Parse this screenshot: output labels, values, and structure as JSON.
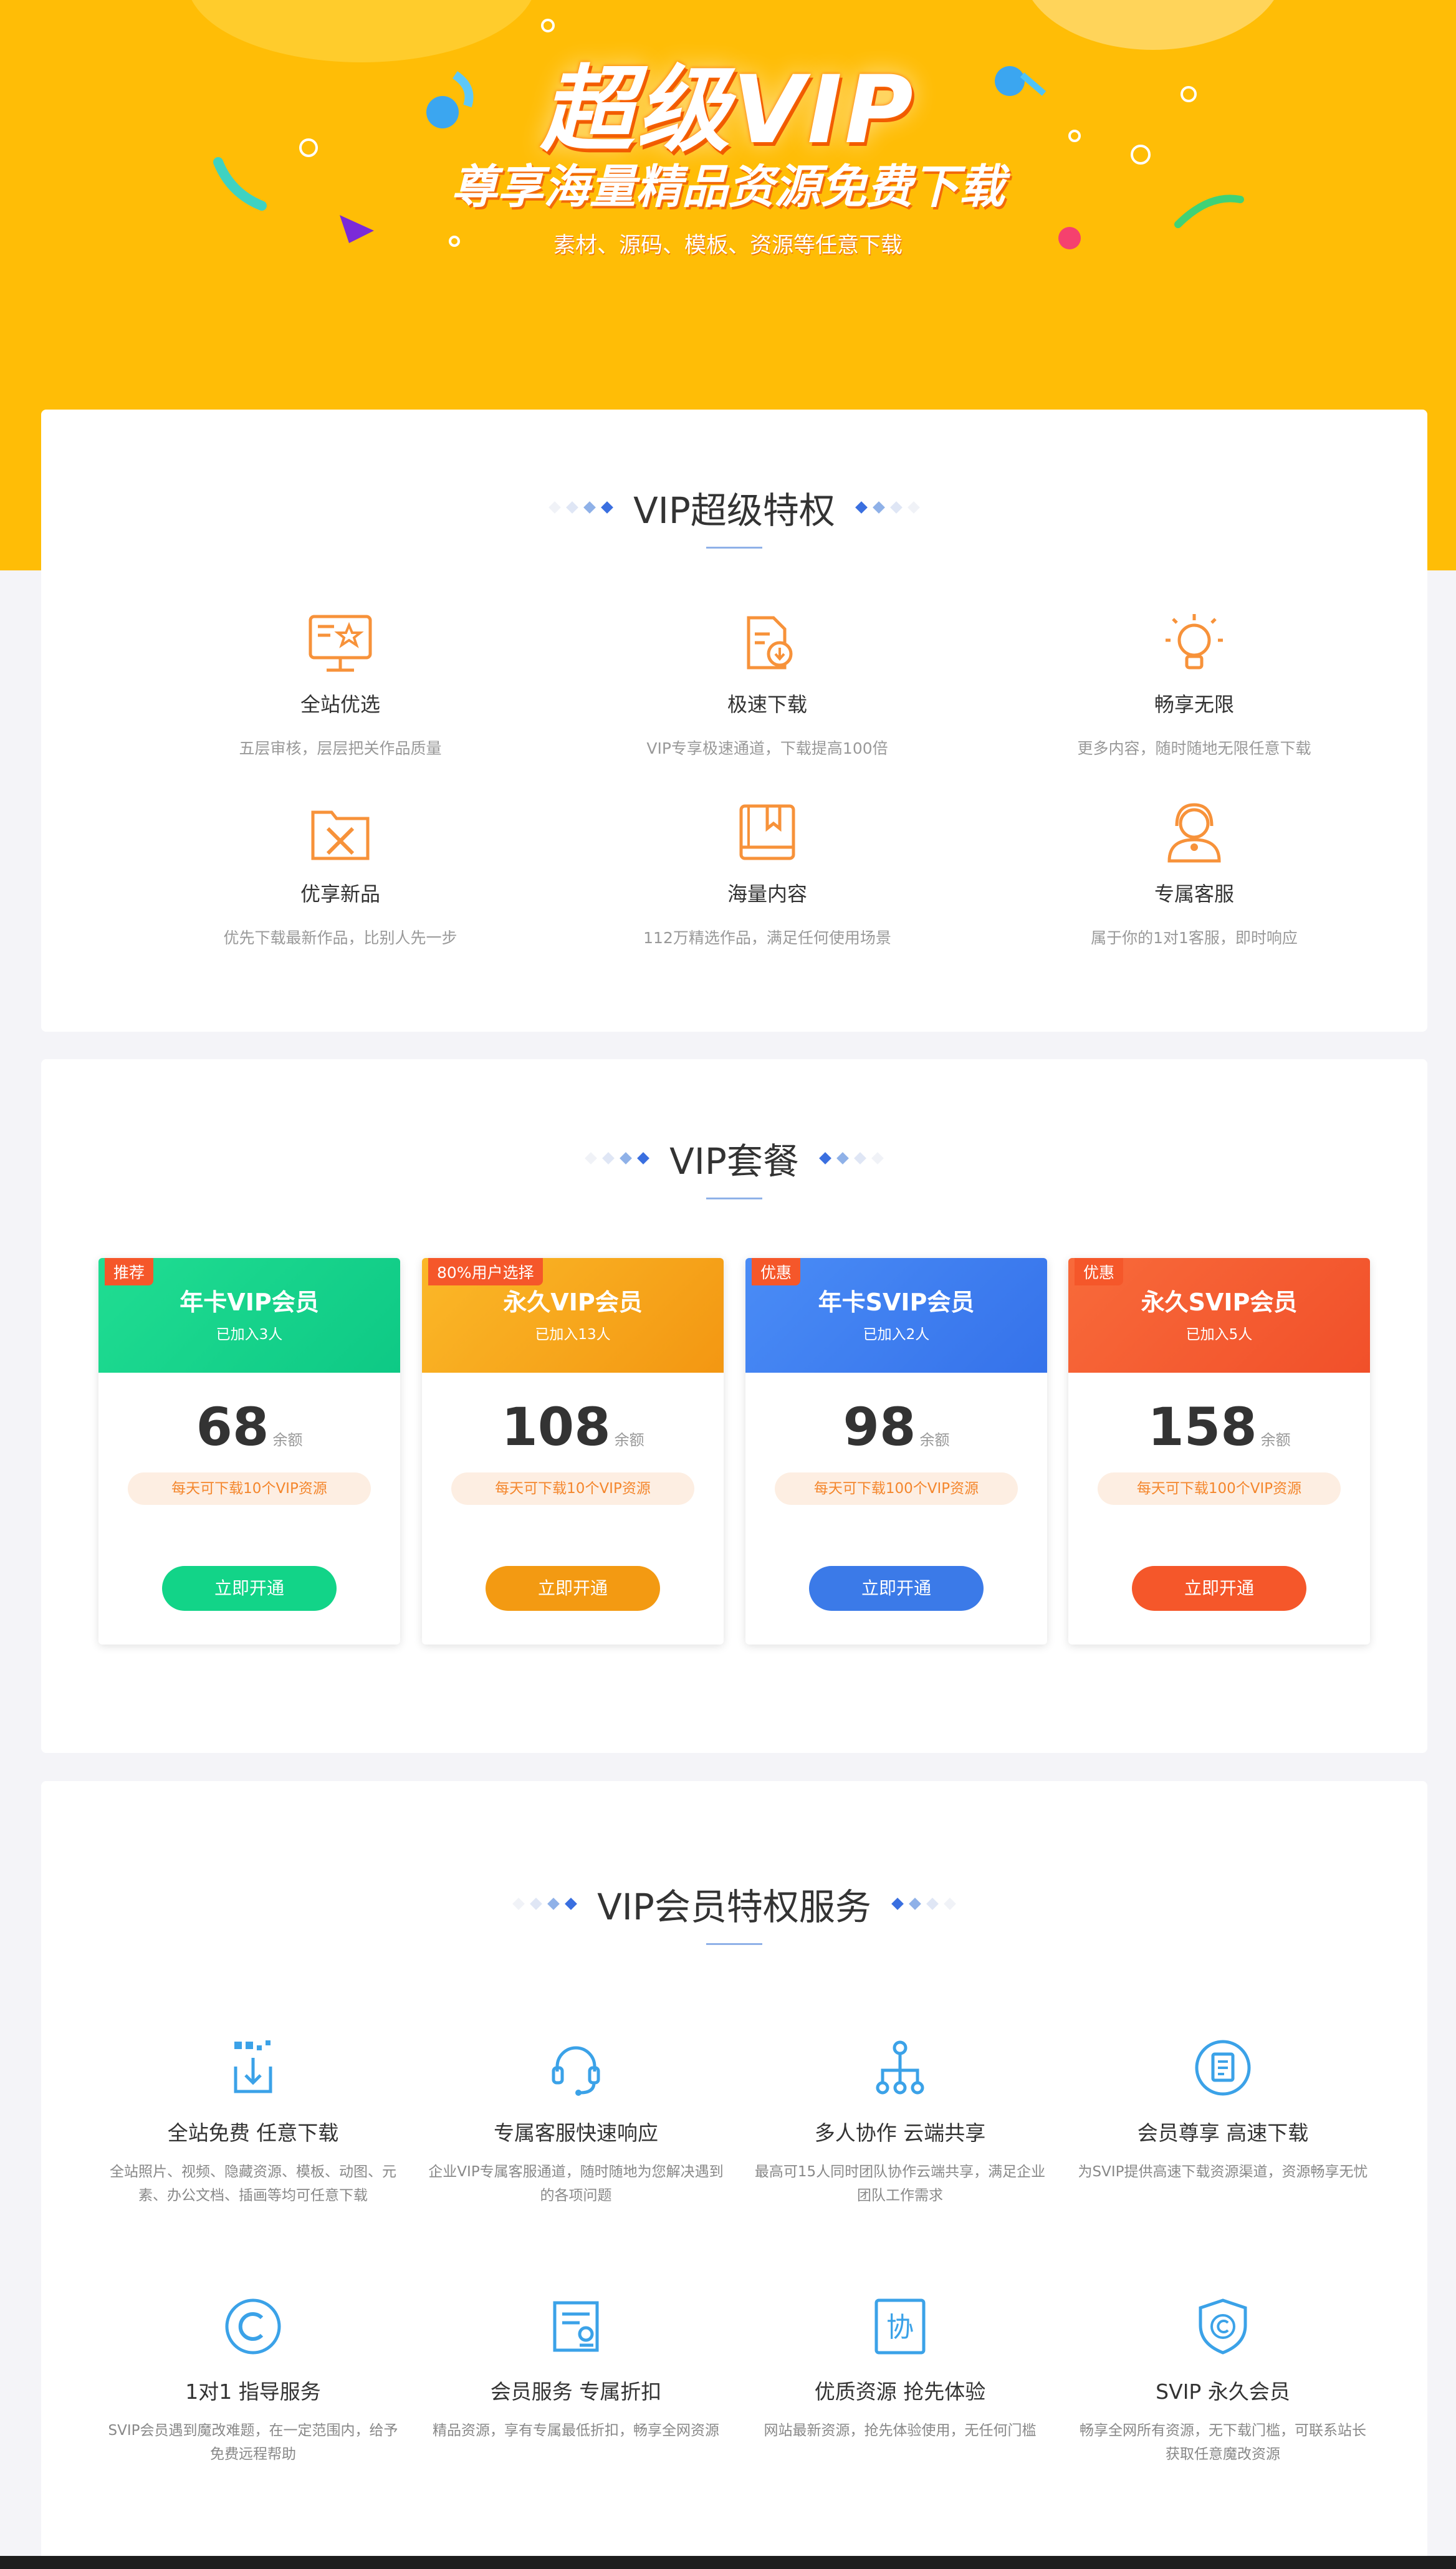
{
  "hero": {
    "title": "超级VIP",
    "subtitle": "尊享海量精品资源免费下载",
    "tagline": "素材、源码、模板、资源等任意下载"
  },
  "privileges": {
    "title": "VIP超级特权",
    "items": [
      {
        "title": "全站优选",
        "desc": "五层审核，层层把关作品质量",
        "icon": "monitor-star-icon"
      },
      {
        "title": "极速下载",
        "desc": "VIP专享极速通道，下载提高100倍",
        "icon": "fast-download-icon"
      },
      {
        "title": "畅享无限",
        "desc": "更多内容，随时随地无限任意下载",
        "icon": "lightbulb-icon"
      },
      {
        "title": "优享新品",
        "desc": "优先下载最新作品，比别人先一步",
        "icon": "folder-tools-icon"
      },
      {
        "title": "海量内容",
        "desc": "112万精选作品，满足任何使用场景",
        "icon": "book-icon"
      },
      {
        "title": "专属客服",
        "desc": "属于你的1对1客服，即时响应",
        "icon": "support-agent-icon"
      }
    ]
  },
  "packages": {
    "title": "VIP套餐",
    "plans": [
      {
        "tag": "推荐",
        "name": "年卡VIP会员",
        "joined": "已加入3人",
        "price": "68",
        "unit": "余额",
        "quota": "每天可下载10个VIP资源",
        "button": "立即开通",
        "color": "#12d488",
        "color2": "#19c98c"
      },
      {
        "tag": "80%用户选择",
        "name": "永久VIP会员",
        "joined": "已加入13人",
        "price": "108",
        "unit": "余额",
        "quota": "每天可下载10个VIP资源",
        "button": "立即开通",
        "color": "#f7a81a",
        "color2": "#f39712"
      },
      {
        "tag": "优惠",
        "name": "年卡SVIP会员",
        "joined": "已加入2人",
        "price": "98",
        "unit": "余额",
        "quota": "每天可下载100个VIP资源",
        "button": "立即开通",
        "color": "#3b7ef2",
        "color2": "#3c78ea"
      },
      {
        "tag": "优惠",
        "name": "永久SVIP会员",
        "joined": "已加入5人",
        "price": "158",
        "unit": "余额",
        "quota": "每天可下载100个VIP资源",
        "button": "立即开通",
        "color": "#f55a2e",
        "color2": "#f5572a"
      }
    ],
    "tag_color": "#f5572a"
  },
  "services": {
    "title": "VIP会员特权服务",
    "items": [
      {
        "title": "全站免费 任意下载",
        "desc": "全站照片、视频、隐藏资源、模板、动图、元素、办公文档、插画等均可任意下载",
        "icon": "download-tray-icon"
      },
      {
        "title": "专属客服快速响应",
        "desc": "企业VIP专属客服通道，随时随地为您解决遇到的各项问题",
        "icon": "headset-icon"
      },
      {
        "title": "多人协作 云端共享",
        "desc": "最高可15人同时团队协作云端共享，满足企业团队工作需求",
        "icon": "team-tree-icon"
      },
      {
        "title": "会员尊享 高速下载",
        "desc": "为SVIP提供高速下载资源渠道，资源畅享无忧",
        "icon": "document-circle-icon"
      },
      {
        "title": "1对1 指导服务",
        "desc": "SVIP会员遇到魔改难题，在一定范围内，给予免费远程帮助",
        "icon": "copyright-icon"
      },
      {
        "title": "会员服务 专属折扣",
        "desc": "精品资源，享有专属最低折扣，畅享全网资源",
        "icon": "certificate-icon"
      },
      {
        "title": "优质资源 抢先体验",
        "desc": "网站最新资源，抢先体验使用，无任何门槛",
        "icon": "cooperate-icon"
      },
      {
        "title": "SVIP 永久会员",
        "desc": "畅享全网所有资源，无下载门槛，可联系站长获取任意魔改资源",
        "icon": "shield-copyright-icon"
      }
    ]
  }
}
